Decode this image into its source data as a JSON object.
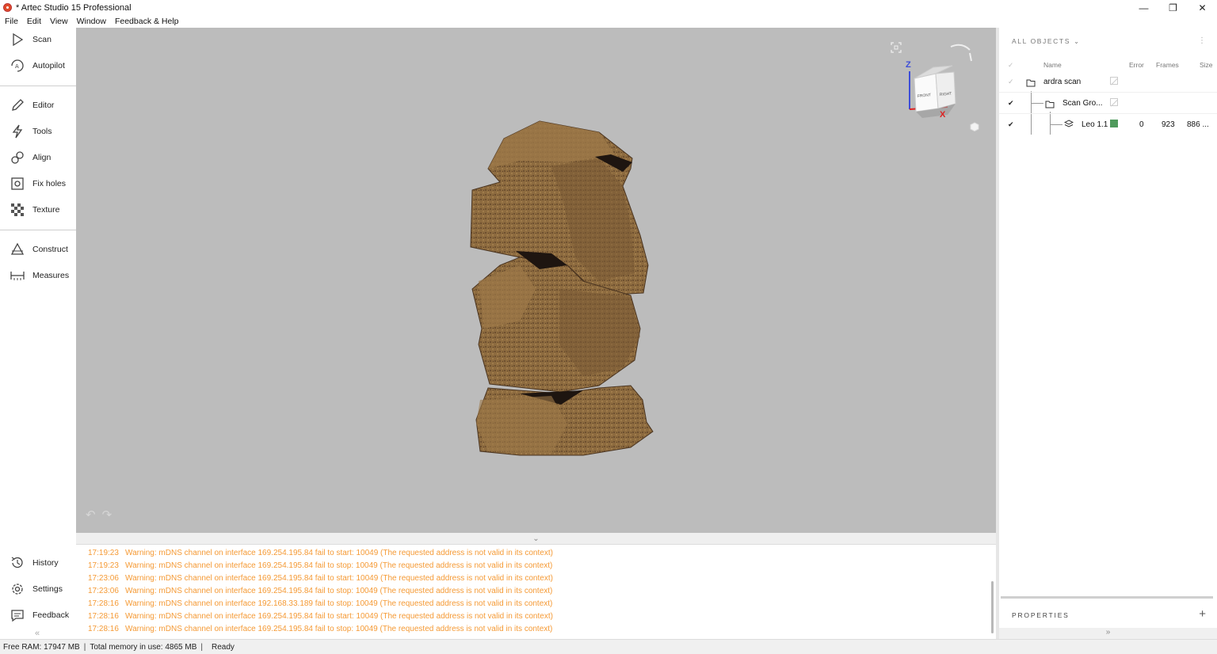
{
  "window": {
    "title": "* Artec Studio 15 Professional",
    "minimize": "—",
    "restore": "❐",
    "close": "✕"
  },
  "menu": [
    "File",
    "Edit",
    "View",
    "Window",
    "Feedback & Help"
  ],
  "sidebar": {
    "items": [
      {
        "label": "Scan",
        "icon": "play-icon"
      },
      {
        "label": "Autopilot",
        "icon": "autopilot-icon"
      },
      {
        "label": "Editor",
        "icon": "pencil-icon"
      },
      {
        "label": "Tools",
        "icon": "lightning-icon"
      },
      {
        "label": "Align",
        "icon": "align-icon"
      },
      {
        "label": "Fix holes",
        "icon": "fix-holes-icon"
      },
      {
        "label": "Texture",
        "icon": "checker-icon"
      },
      {
        "label": "Construct",
        "icon": "triangle-icon"
      },
      {
        "label": "Measures",
        "icon": "ruler-icon"
      },
      {
        "label": "History",
        "icon": "history-icon"
      },
      {
        "label": "Settings",
        "icon": "gear-icon"
      },
      {
        "label": "Feedback",
        "icon": "comment-icon"
      }
    ],
    "collapse": "«"
  },
  "viewport": {
    "undo": "↶",
    "redo": "↷",
    "gizmo": {
      "z": "Z",
      "x": "X",
      "front": "FRONT",
      "right": "RIGHT"
    }
  },
  "log": {
    "collapse": "⌄",
    "entries": [
      {
        "time": "17:19:23",
        "text": "Warning: mDNS channel on interface 169.254.195.84 fail to start: 10049 (The requested address is not valid in its context)"
      },
      {
        "time": "17:19:23",
        "text": "Warning: mDNS channel on interface 169.254.195.84 fail to stop: 10049 (The requested address is not valid in its context)"
      },
      {
        "time": "17:23:06",
        "text": "Warning: mDNS channel on interface 169.254.195.84 fail to start: 10049 (The requested address is not valid in its context)"
      },
      {
        "time": "17:23:06",
        "text": "Warning: mDNS channel on interface 169.254.195.84 fail to stop: 10049 (The requested address is not valid in its context)"
      },
      {
        "time": "17:28:16",
        "text": "Warning: mDNS channel on interface 192.168.33.189 fail to stop: 10049 (The requested address is not valid in its context)"
      },
      {
        "time": "17:28:16",
        "text": "Warning: mDNS channel on interface 169.254.195.84 fail to start: 10049 (The requested address is not valid in its context)"
      },
      {
        "time": "17:28:16",
        "text": "Warning: mDNS channel on interface 169.254.195.84 fail to stop: 10049 (The requested address is not valid in its context)"
      }
    ]
  },
  "objects_panel": {
    "header": "ALL OBJECTS",
    "dropdown": "⌄",
    "menu": "⋮",
    "columns": {
      "check": "✓",
      "name": "Name",
      "error": "Error",
      "frames": "Frames",
      "size": "Size"
    },
    "rows": [
      {
        "check": "✓",
        "name": "ardra scan"
      },
      {
        "check": "✔",
        "name": "Scan Gro..."
      },
      {
        "check": "✔",
        "name": "Leo 1.1",
        "color": "#4f9a5c",
        "error": "0",
        "frames": "923",
        "size": "886 ..."
      }
    ]
  },
  "properties_panel": {
    "header": "PROPERTIES",
    "add": "+",
    "collapse": "»"
  },
  "status": {
    "free_ram": "Free RAM: 17947 MB",
    "total_memory": "Total memory in use: 4865 MB",
    "state": "Ready",
    "sep": "|"
  },
  "colors": {
    "warning": "#f59a35",
    "viewport_bg": "#bcbcbc",
    "model": "#8b6a3e"
  }
}
